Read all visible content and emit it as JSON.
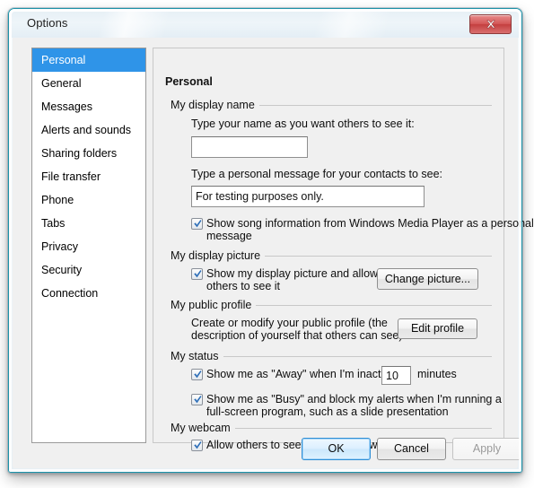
{
  "window": {
    "title": "Options",
    "close_icon": "close-x-icon",
    "accent_color": "#1d93a8",
    "selection_color": "#2f94e8"
  },
  "sidebar": {
    "items": [
      {
        "label": "Personal",
        "selected": true
      },
      {
        "label": "General",
        "selected": false
      },
      {
        "label": "Messages",
        "selected": false
      },
      {
        "label": "Alerts and sounds",
        "selected": false
      },
      {
        "label": "Sharing folders",
        "selected": false
      },
      {
        "label": "File transfer",
        "selected": false
      },
      {
        "label": "Phone",
        "selected": false
      },
      {
        "label": "Tabs",
        "selected": false
      },
      {
        "label": "Privacy",
        "selected": false
      },
      {
        "label": "Security",
        "selected": false
      },
      {
        "label": "Connection",
        "selected": false
      }
    ]
  },
  "panel": {
    "legend": "Personal",
    "display_name": {
      "group_title": "My display name",
      "name_label": "Type your name as you want others to see it:",
      "name_value": "",
      "message_label": "Type a personal message for your contacts to see:",
      "message_value": "For testing purposes only.",
      "song_checkbox": {
        "line1": "Show song information from Windows Media Player as a personal",
        "line2": "message",
        "checked": true
      }
    },
    "display_picture": {
      "group_title": "My display picture",
      "checkbox": {
        "line1": "Show my display picture and allow",
        "line2": "others to see it",
        "checked": true
      },
      "change_button": "Change picture..."
    },
    "public_profile": {
      "group_title": "My public profile",
      "description_line1": "Create or modify your public profile (the",
      "description_line2": "description of yourself that others can see)",
      "edit_button": "Edit profile"
    },
    "status": {
      "group_title": "My status",
      "away": {
        "label_before": "Show me as \"Away\" when I'm inactive :",
        "minutes_value": "10",
        "label_after": "minutes",
        "checked": true
      },
      "busy": {
        "line1": "Show me as \"Busy\" and block my alerts when I'm running a",
        "line2": "full-screen program, such as a slide presentation",
        "checked": true
      }
    },
    "webcam": {
      "group_title": "My webcam",
      "checkbox": {
        "label": "Allow others to see that I have a webcam",
        "checked": true
      }
    }
  },
  "footer": {
    "ok": "OK",
    "cancel": "Cancel",
    "apply": "Apply"
  }
}
